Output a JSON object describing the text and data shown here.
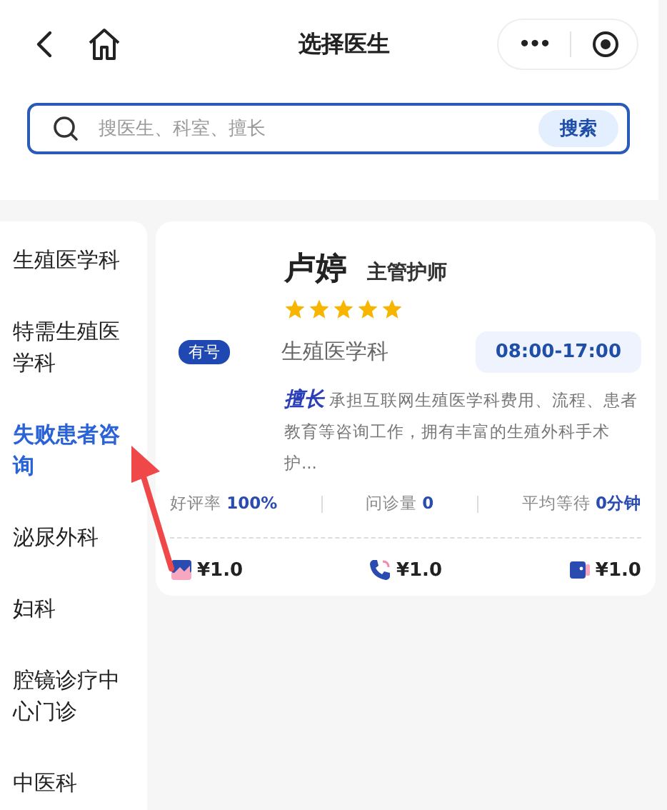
{
  "header": {
    "title": "选择医生",
    "more": "•••"
  },
  "search": {
    "placeholder": "搜医生、科室、擅长",
    "button": "搜索"
  },
  "sidebar": {
    "items": [
      {
        "label": "生殖医学科",
        "selected": false
      },
      {
        "label": "特需生殖医学科",
        "selected": false
      },
      {
        "label": "失败患者咨询",
        "selected": true
      },
      {
        "label": "泌尿外科",
        "selected": false
      },
      {
        "label": "妇科",
        "selected": false
      },
      {
        "label": "腔镜诊疗中心门诊",
        "selected": false
      },
      {
        "label": "中医科",
        "selected": false
      }
    ]
  },
  "doctor": {
    "name": "卢婷",
    "title": "主管护师",
    "stars": 5,
    "badge": "有号",
    "department": "生殖医学科",
    "hours": "08:00-17:00",
    "specialty_label": "擅长",
    "specialty": "承担互联网生殖医学科费用、流程、患者教育等咨询工作，拥有丰富的生殖外科手术护...",
    "stats": [
      {
        "label": "好评率",
        "value": "100%"
      },
      {
        "label": "问诊量",
        "value": "0"
      },
      {
        "label": "平均等待",
        "value": "0分钟"
      }
    ],
    "prices": [
      {
        "kind": "image",
        "price": "¥1.0"
      },
      {
        "kind": "phone",
        "price": "¥1.0"
      },
      {
        "kind": "video",
        "price": "¥1.0"
      }
    ]
  }
}
